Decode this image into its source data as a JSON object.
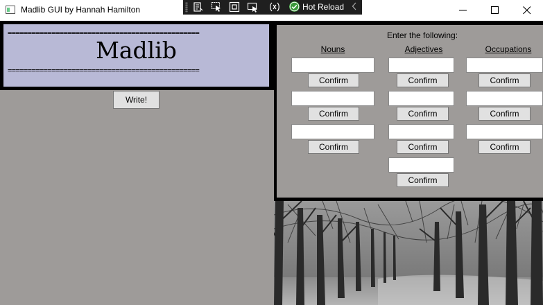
{
  "window": {
    "title": "Madlib GUI by Hannah Hamilton"
  },
  "devbar": {
    "hot_reload_label": "Hot Reload"
  },
  "banner": {
    "rule": "================================================",
    "title": "Madlib"
  },
  "write_button": "Write!",
  "form": {
    "prompt": "Enter the following:",
    "columns": [
      {
        "header": "Nouns",
        "fields": [
          {
            "value": "",
            "confirm": "Confirm"
          },
          {
            "value": "",
            "confirm": "Confirm"
          },
          {
            "value": "",
            "confirm": "Confirm"
          }
        ]
      },
      {
        "header": "Adjectives",
        "fields": [
          {
            "value": "",
            "confirm": "Confirm"
          },
          {
            "value": "",
            "confirm": "Confirm"
          },
          {
            "value": "",
            "confirm": "Confirm"
          },
          {
            "value": "",
            "confirm": "Confirm"
          }
        ]
      },
      {
        "header": "Occupations",
        "fields": [
          {
            "value": "",
            "confirm": "Confirm"
          },
          {
            "value": "",
            "confirm": "Confirm"
          },
          {
            "value": "",
            "confirm": "Confirm"
          }
        ]
      }
    ]
  },
  "icons": {
    "app": "window-app-icon",
    "devbar": [
      "live-visual-tree-icon",
      "select-element-icon",
      "display-layout-adorners-icon",
      "track-focus-icon",
      "binding-failures-icon",
      "hot-reload-check-icon",
      "collapse-toolbar-icon"
    ],
    "window_controls": [
      "minimize-icon",
      "maximize-icon",
      "close-icon"
    ]
  },
  "colors": {
    "panel_bg": "#9e9b99",
    "banner_bg": "#b8b9d6",
    "frame": "#000000",
    "button_bg": "#e1e1e1",
    "hot_reload_green": "#3a9a3a"
  }
}
